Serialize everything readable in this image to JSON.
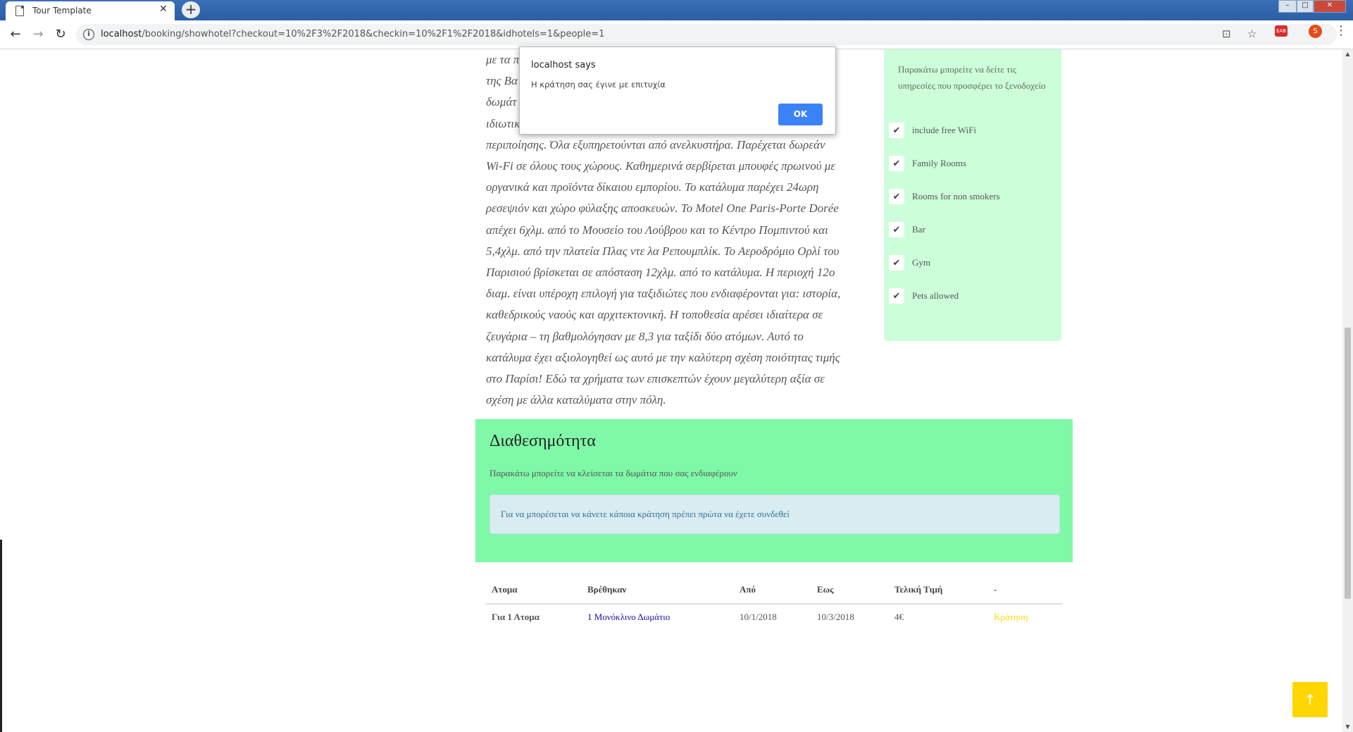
{
  "browser": {
    "tab_title": "Tour Template",
    "tab_close": "✕",
    "new_tab": "+",
    "url_host": "localhost",
    "url_path": "/booking/showhotel?checkout=10%2F3%2F2018&checkin=10%2F1%2F2018&idhotels=1&people=1",
    "back": "←",
    "forward": "→",
    "reload": "↻",
    "info": "i",
    "translate_icon": "⊡",
    "star": "☆",
    "ext_label": "EAB",
    "avatar_letter": "S",
    "menu": "⋮",
    "win_min": "–",
    "win_max": "□",
    "win_close": "✕"
  },
  "description": {
    "lines": [
      "με τα π                                                                  ιτερα",
      "της Βα                                                                   ύμενα",
      "δωμάτ                                                                     ται",
      "ιδιωτικ",
      "περιποίησης. Όλα εξυπηρετούνται από ανελκυστήρα. Παρέχεται δωρεάν",
      "Wi-Fi σε όλους τους χώρους. Καθημερινά σερβίρεται μπουφές πρωινού με",
      "οργανικά και προϊόντα δίκαιου εμπορίου. Το κατάλυμα παρέχει 24ωρη",
      "ρεσεψιόν και χώρο φύλαξης αποσκευών. Το Motel One Paris-Porte Dorée",
      "απέχει 6χλμ. από το Μουσείο του Λούβρου και το Κέντρο Πομπιντού και",
      "5,4χλμ. από την πλατεία Πλας ντε λα Ρεπουμπλίκ. Το Αεροδρόμιο Ορλί του",
      "Παρισιού βρίσκεται σε απόσταση 12χλμ. από το κατάλυμα. Η περιοχή 12ο",
      "διαμ. είναι υπέροχη επιλογή για ταξιδιώτες που ενδιαφέρονται για: ιστορία,",
      "καθεδρικούς ναούς και αρχιτεκτονική. Η τοποθεσία αρέσει ιδιαίτερα σε",
      "ζευγάρια – τη βαθμολόγησαν με 8,3 για ταξίδι δύο ατόμων. Αυτό το",
      "κατάλυμα έχει αξιολογηθεί ως αυτό με την καλύτερη σχέση ποιότητας τιμής",
      "στο Παρίσι! Εδώ τα χρήματα των επισκεπτών έχουν μεγαλύτερη αξία σε",
      "σχέση με άλλα καταλύματα στην πόλη."
    ]
  },
  "services": {
    "intro": "Παρακάτω μπορείτε να δείτε τις υπηρεσίες που προσφέρει το ξενοδοχείο",
    "check": "✔",
    "items": [
      "include free WiFi",
      "Family Rooms",
      "Rooms for non smokers",
      "Bar",
      "Gym",
      "Pets allowed"
    ]
  },
  "availability": {
    "title": "Διαθεσημότητα",
    "subtitle": "Παρακάτω μπορείτε να κλείσεται τα δωμάτια που σας ενδιαφέρουν",
    "alert": "Για να μπορέσεται να κάνετε κάποια κράτηση πρέπει πρώτα να έχετε συνδεθεί"
  },
  "table": {
    "headers": [
      "Ατομα",
      "Βρέθηκαν",
      "Από",
      "Εως",
      "Τελική Τιμή",
      "-"
    ],
    "row": {
      "people": "Για 1 Ατομα",
      "room": "1 Μονόκλινο Δωμάτιο",
      "from": "10/1/2018",
      "to": "10/3/2018",
      "price": "4€",
      "action": "Κράτηση"
    }
  },
  "to_top": "↑",
  "dialog": {
    "title": "localhost says",
    "message": "Η κράτηση σας έγινε με επιτυχία",
    "ok": "OK"
  },
  "colors": {
    "services_bg": "#ccffd9",
    "availability_bg": "#7ff8a8",
    "alert_bg": "#d9ecf2",
    "book_link": "#ffd600",
    "to_top_bg": "#ffd600",
    "dialog_ok": "#3b82f6"
  }
}
